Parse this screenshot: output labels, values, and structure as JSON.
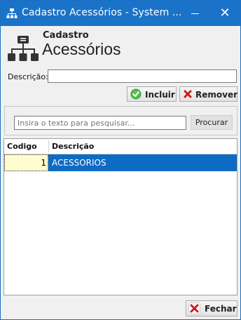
{
  "window": {
    "title": "Cadastro Acessórios -  System ...",
    "close_glyph": "✕"
  },
  "header": {
    "subtitle": "Cadastro",
    "title": "Acessórios",
    "icon": "sitemap-icon"
  },
  "form": {
    "descricao_label": "Descrição:",
    "descricao_value": ""
  },
  "buttons": {
    "incluir": "Incluir",
    "remover": "Remover",
    "procurar": "Procurar",
    "fechar": "Fechar"
  },
  "search": {
    "placeholder": "Insira o texto para pesquisar..."
  },
  "grid": {
    "columns": [
      "Codigo",
      "Descrição"
    ],
    "rows": [
      {
        "codigo": "1",
        "descricao": "ACESSORIOS"
      }
    ]
  },
  "colors": {
    "titlebar": "#1a73c8",
    "selection": "#0e6bc4",
    "edit_cell": "#fffdd0"
  }
}
